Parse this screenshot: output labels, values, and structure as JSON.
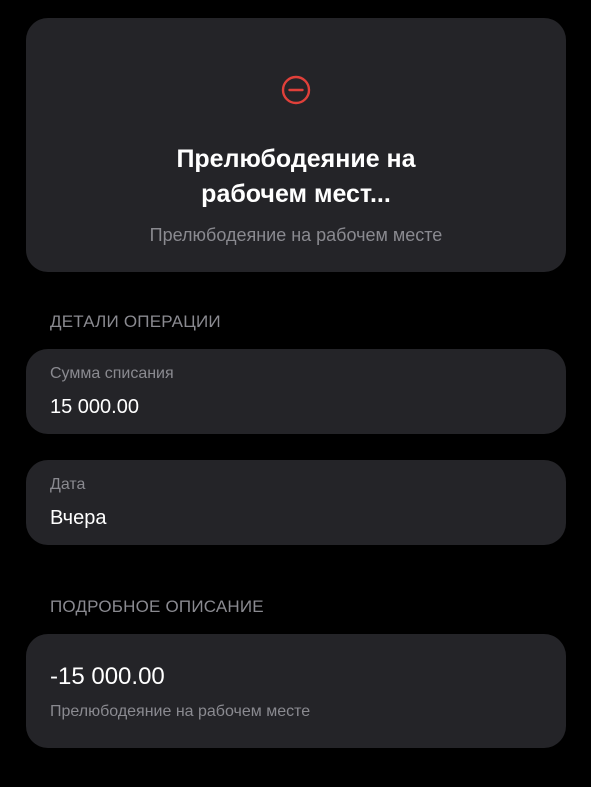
{
  "header": {
    "status_icon": "minus-circle-icon",
    "status_color": "#e0403a",
    "title_line1": "Прелюбодеяние на",
    "title_line2": "рабочем мест...",
    "subtitle": "Прелюбодеяние на рабочем месте"
  },
  "details": {
    "section_label": "ДЕТАЛИ ОПЕРАЦИИ",
    "amount": {
      "label": "Сумма списания",
      "value": "15 000.00"
    },
    "date": {
      "label": "Дата",
      "value": "Вчера"
    }
  },
  "description": {
    "section_label": "ПОДРОБНОЕ ОПИСАНИЕ",
    "amount": "-15 000.00",
    "text": "Прелюбодеяние на рабочем месте"
  }
}
